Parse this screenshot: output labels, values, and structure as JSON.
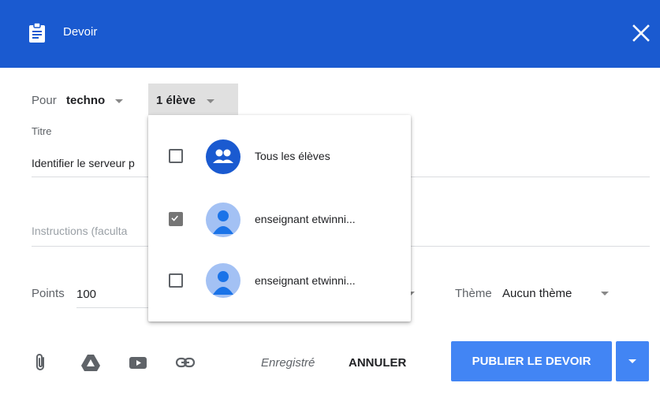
{
  "header": {
    "title": "Devoir",
    "icon": "assignment-icon",
    "background": "#1a5ad0"
  },
  "form": {
    "pour_label": "Pour",
    "class_value": "techno",
    "students_value": "1 élève",
    "titre_label": "Titre",
    "titre_value": "Identifier le serveur p",
    "instructions_placeholder": "Instructions (faculta",
    "points_label": "Points",
    "points_value": "100",
    "theme_label": "Thème",
    "theme_value": "Aucun thème"
  },
  "students_dropdown": {
    "options": [
      {
        "label": "Tous les élèves",
        "checked": false,
        "icon": "group-icon"
      },
      {
        "label": "enseignant etwinni...",
        "checked": true,
        "icon": "person-icon"
      },
      {
        "label": "enseignant etwinni...",
        "checked": false,
        "icon": "person-icon"
      }
    ]
  },
  "footer": {
    "saved_text": "Enregistré",
    "cancel_label": "ANNULER",
    "publish_label": "PUBLIER LE DEVOIR",
    "icons": [
      "attach-icon",
      "drive-icon",
      "youtube-icon",
      "link-icon"
    ]
  },
  "colors": {
    "primary": "#4285f4",
    "header": "#1a5ad0",
    "avatar": "#a3c1f4",
    "group_avatar": "#1a5ad0"
  }
}
